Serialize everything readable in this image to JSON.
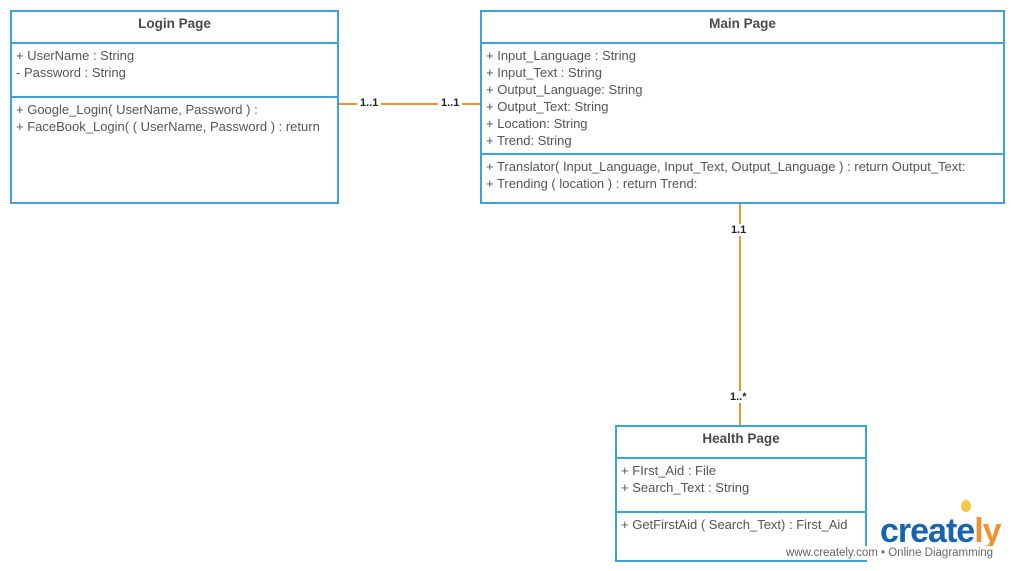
{
  "classes": {
    "login": {
      "title": "Login Page",
      "attributes": [
        "+ UserName : String",
        "- Password : String"
      ],
      "methods": [
        "+ Google_Login( UserName, Password ) :",
        "+ FaceBook_Login( ( UserName, Password ) : return"
      ]
    },
    "main": {
      "title": "Main Page",
      "attributes": [
        "+ Input_Language : String",
        "+ Input_Text : String",
        "+ Output_Language: String",
        "+ Output_Text: String",
        "+ Location: String",
        "+ Trend: String"
      ],
      "methods": [
        "+ Translator( Input_Language, Input_Text, Output_Language ) : return Output_Text:",
        "+ Trending ( location ) : return Trend:"
      ]
    },
    "health": {
      "title": "Health Page",
      "attributes": [
        "+ FIrst_Aid : File",
        "+ Search_Text : String"
      ],
      "methods": [
        "+ GetFirstAid ( Search_Text) : First_Aid"
      ]
    }
  },
  "associations": [
    {
      "from": "Login Page",
      "to": "Main Page",
      "from_mult": "1..1",
      "to_mult": "1..1"
    },
    {
      "from": "Main Page",
      "to": "Health Page",
      "from_mult": "1.1",
      "to_mult": "1..*"
    }
  ],
  "watermark": {
    "logo_main": "creat",
    "logo_end": "ly",
    "logo_e": "e",
    "tagline": "www.creately.com • Online Diagramming"
  },
  "colors": {
    "border": "#3aa3de",
    "connector": "#f0922e"
  }
}
